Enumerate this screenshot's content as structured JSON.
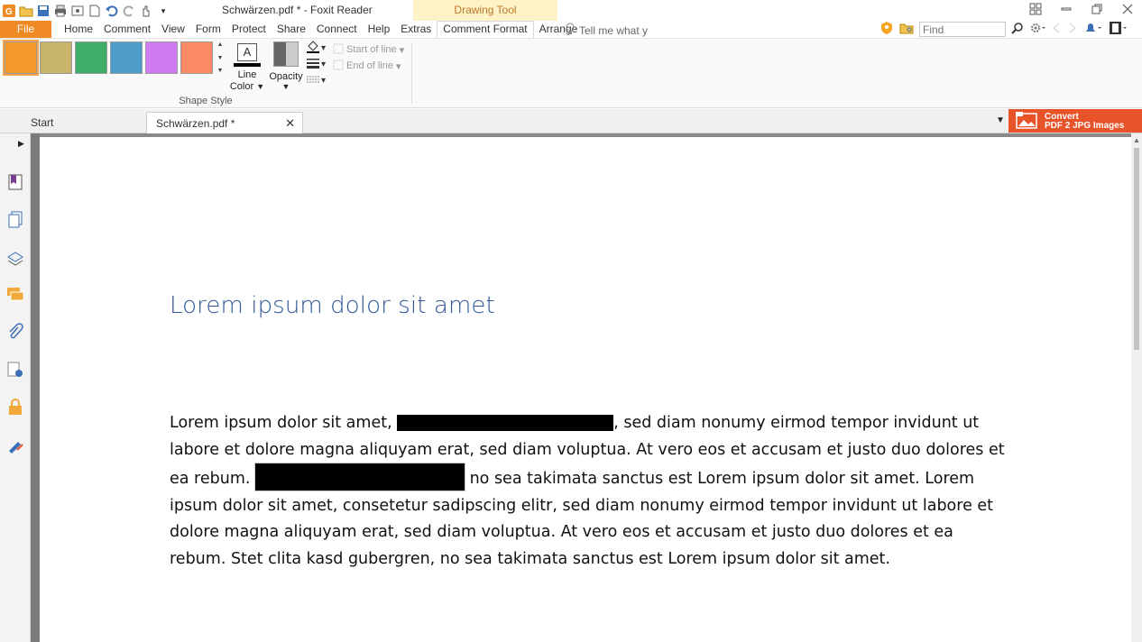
{
  "window": {
    "title": "Schwärzen.pdf * - Foxit Reader",
    "context_tab": "Drawing Tool"
  },
  "menu": {
    "file": "File",
    "tabs": [
      "Home",
      "Comment",
      "View",
      "Form",
      "Protect",
      "Share",
      "Connect",
      "Help",
      "Extras",
      "Comment Format",
      "Arrange"
    ],
    "active_tab": "Comment Format",
    "tell_me": "Tell me what y",
    "find_placeholder": "Find"
  },
  "ribbon": {
    "swatches": [
      "#f39a2a",
      "#c8b56a",
      "#3fae6a",
      "#4f9bc9",
      "#cf7cf3",
      "#fc8a64"
    ],
    "selected_swatch": 0,
    "line_color_label_1": "Line",
    "line_color_label_2": "Color",
    "opacity_label": "Opacity",
    "start_of_line": "Start of line",
    "end_of_line": "End of line",
    "group_label": "Shape Style"
  },
  "doc_tabs": {
    "start": "Start",
    "current": "Schwärzen.pdf *"
  },
  "convert_banner": {
    "line1": "Convert",
    "line2": "PDF 2 JPG Images"
  },
  "document": {
    "heading": "Lorem ipsum dolor sit amet",
    "p1_a": "Lorem ipsum dolor sit amet, ",
    "p1_b": ", sed diam nonumy eirmod tempor invidunt ut labore et dolore magna aliquyam erat, sed diam voluptua. At vero eos et accusam et justo duo dolores et ea rebum. ",
    "p1_c": " no sea takimata sanctus est Lorem ipsum dolor sit amet. Lorem ipsum dolor sit amet, consetetur sadipscing elitr, sed diam nonumy eirmod tempor invidunt ut labore et dolore magna aliquyam erat, sed diam voluptua. At vero eos et accusam et justo duo dolores et ea rebum. Stet clita kasd gubergren, no sea takimata sanctus est Lorem ipsum dolor sit amet."
  }
}
